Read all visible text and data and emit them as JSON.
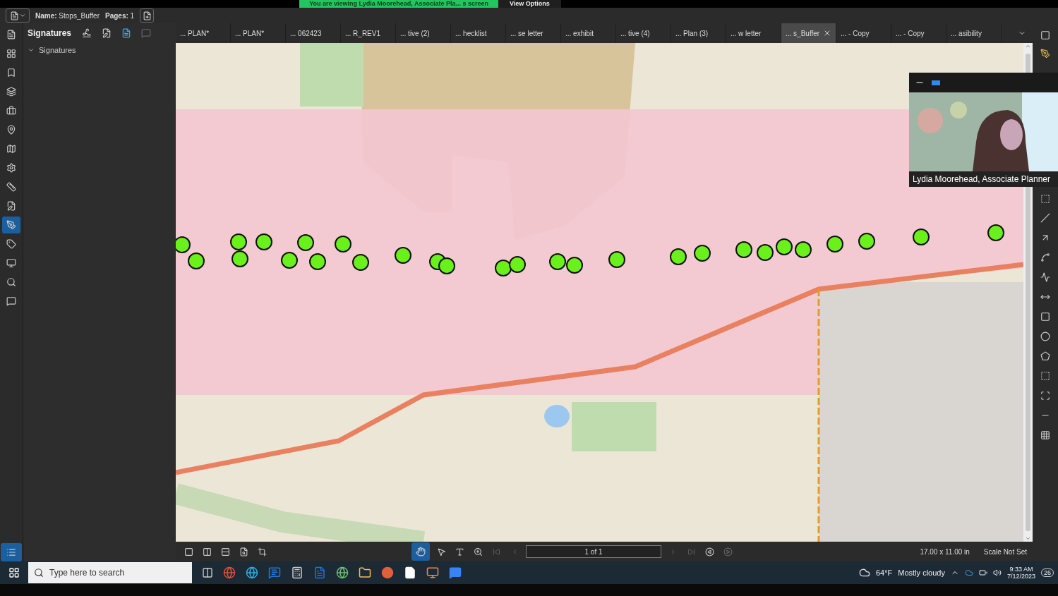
{
  "share_banner": {
    "text": "You are viewing Lydia Moorehead, Associate Pla... s screen",
    "options": "View Options"
  },
  "toolbar": {
    "name_label": "Name:",
    "name": "Stops_Buffer",
    "pages_label": "Pages:",
    "pages": "1"
  },
  "left_rail": [
    {
      "selected": false
    },
    {
      "selected": false
    },
    {
      "selected": false
    },
    {
      "selected": false
    },
    {
      "selected": false
    },
    {
      "selected": false
    },
    {
      "selected": false
    },
    {
      "selected": false
    },
    {
      "selected": false
    },
    {
      "selected": false
    },
    {
      "selected": true
    },
    {
      "selected": false
    },
    {
      "selected": false
    },
    {
      "selected": false
    },
    {
      "selected": false
    }
  ],
  "panel": {
    "title": "Signatures",
    "tree": [
      {
        "label": "Signatures",
        "expanded": true
      }
    ]
  },
  "tabs": [
    {
      "label": "... PLAN*",
      "selected": false
    },
    {
      "label": "... PLAN*",
      "selected": false
    },
    {
      "label": "... 062423",
      "selected": false
    },
    {
      "label": "... R_REV1",
      "selected": false
    },
    {
      "label": "... tive (2)",
      "selected": false
    },
    {
      "label": "... hecklist",
      "selected": false
    },
    {
      "label": "... se letter",
      "selected": false
    },
    {
      "label": "... exhibit",
      "selected": false
    },
    {
      "label": "... tive (4)",
      "selected": false
    },
    {
      "label": "... Plan (3)",
      "selected": false
    },
    {
      "label": "... w letter",
      "selected": false
    },
    {
      "label": "... s_Buffer",
      "selected": true
    },
    {
      "label": "... - Copy",
      "selected": false
    },
    {
      "label": "... - Copy",
      "selected": false
    },
    {
      "label": "... asibility",
      "selected": false
    }
  ],
  "video": {
    "caption": "Lydia Moorehead, Associate Planner"
  },
  "status_bar": {
    "page": "1 of 1",
    "size": "17.00 x 11.00 in",
    "scale": "Scale Not Set"
  },
  "taskbar": {
    "search_placeholder": "Type here to search",
    "temperature": "64°F",
    "condition": "Mostly cloudy",
    "time": "9:33 AM",
    "date": "7/12/2023",
    "notifications": "26"
  }
}
